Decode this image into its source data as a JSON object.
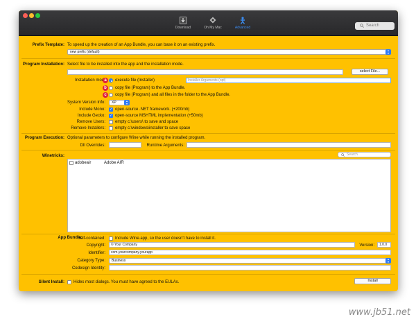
{
  "toolbar": {
    "items": [
      {
        "label": "Download",
        "icon": "download-icon"
      },
      {
        "label": "Oh My Mac",
        "icon": "tools-icon"
      },
      {
        "label": "Advanced",
        "icon": "advanced-icon"
      }
    ],
    "search_placeholder": "Search"
  },
  "prefix_template": {
    "label": "Prefix Template:",
    "description": "To speed up the creation of an App Bundle, you can base it on an existing prefix.",
    "selected": "new prefix (default)"
  },
  "program_installation": {
    "label": "Program Installation:",
    "description": "Select file to be installed into the app and the installation mode.",
    "select_file_button": "select File...",
    "installation_mode_label": "Installation mod",
    "modes": [
      {
        "marker": "a",
        "text": "execute file (Installer)"
      },
      {
        "marker": "b",
        "text": "copy file (Program)  to the App Bundle."
      },
      {
        "marker": "c",
        "text": "copy file (Program)  and all files in the folder to the App Bundle."
      }
    ],
    "installer_arguments_placeholder": "Installer Arguments (opt)",
    "system_version_label": "System Version Info:",
    "system_version_value": "XP",
    "include_mono_label": "Include Mono:",
    "include_mono_text": "open-source .NET framework. (+200mb)",
    "include_gecko_label": "Include Gecko:",
    "include_gecko_text": "open-source MSHTML implementation (+50mb)",
    "remove_users_label": "Remove Users:",
    "remove_users_text": "empty c:\\users\\ to save and space",
    "remove_installers_label": "Remove Installers:",
    "remove_installers_text": "empty c:\\windows\\installer to save space"
  },
  "program_execution": {
    "label": "Program Execution:",
    "description": "Optional parameters to configure Wine while running the installed program.",
    "dll_overrides_label": "Dll Overrides:",
    "runtime_arguments_label": "Runtime Arguments:"
  },
  "winetricks": {
    "label": "Winetricks:",
    "search_placeholder": "Search",
    "items": [
      {
        "name": "adobeair",
        "description": "Adobe AIR"
      }
    ]
  },
  "app_bundle": {
    "label": "App Bundle:",
    "self_contained_label": "Self-contained:",
    "self_contained_text": "Include Wine.app, so the user doesn't have to install it.",
    "copyright_label": "Copyright:",
    "copyright_value": "© Your Company",
    "version_label": "Version:",
    "version_value": "1.0.0",
    "identifier_label": "Identifier:",
    "identifier_value": "com.yourcompany.yourapp",
    "category_label": "Category Type:",
    "category_value": "Business",
    "codesign_label": "Codesign Identity:"
  },
  "silent_install": {
    "label": "Silent Install:",
    "text": "Hides most dialogs. You must have agreed to the EULAs.",
    "install_button": "Install"
  },
  "watermark": "www.jb51.net"
}
